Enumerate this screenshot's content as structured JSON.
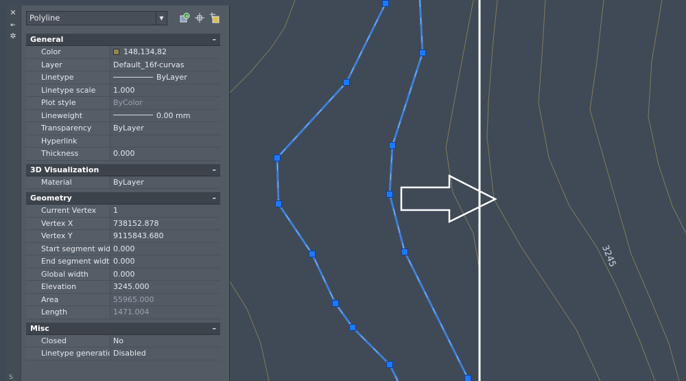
{
  "palette": {
    "object_type": "Polyline",
    "strip_icons": [
      "close-icon",
      "autohide-icon",
      "settings-icon"
    ],
    "toolbar_icons": [
      "toggle-pickadd-icon",
      "select-objects-icon",
      "quick-select-icon"
    ],
    "sections": {
      "general": {
        "title": "General",
        "rows": [
          {
            "label": "Color",
            "value": "148,134,82"
          },
          {
            "label": "Layer",
            "value": "Default_16f-curvas"
          },
          {
            "label": "Linetype",
            "value": "ByLayer"
          },
          {
            "label": "Linetype scale",
            "value": "1.000"
          },
          {
            "label": "Plot style",
            "value": "ByColor"
          },
          {
            "label": "Lineweight",
            "value": "0.00 mm"
          },
          {
            "label": "Transparency",
            "value": "ByLayer"
          },
          {
            "label": "Hyperlink",
            "value": ""
          },
          {
            "label": "Thickness",
            "value": "0.000"
          }
        ]
      },
      "visualization": {
        "title": "3D Visualization",
        "rows": [
          {
            "label": "Material",
            "value": "ByLayer"
          }
        ]
      },
      "geometry": {
        "title": "Geometry",
        "rows": [
          {
            "label": "Current Vertex",
            "value": "1"
          },
          {
            "label": "Vertex X",
            "value": "738152.878"
          },
          {
            "label": "Vertex Y",
            "value": "9115843.680"
          },
          {
            "label": "Start segment width",
            "value": "0.000"
          },
          {
            "label": "End segment width",
            "value": "0.000"
          },
          {
            "label": "Global width",
            "value": "0.000"
          },
          {
            "label": "Elevation",
            "value": "3245.000"
          },
          {
            "label": "Area",
            "value": "55965.000"
          },
          {
            "label": "Length",
            "value": "1471.004"
          }
        ]
      },
      "misc": {
        "title": "Misc",
        "rows": [
          {
            "label": "Closed",
            "value": "No"
          },
          {
            "label": "Linetype generation",
            "value": "Disabled"
          }
        ]
      }
    },
    "color_swatch": "#948652"
  },
  "drawing": {
    "contour_label": "3245",
    "contour_color": "#8f855c",
    "selected_polyline_color": "#3f7fd6",
    "grip_color": "#1e78ff",
    "divider_color": "#ffffff"
  }
}
